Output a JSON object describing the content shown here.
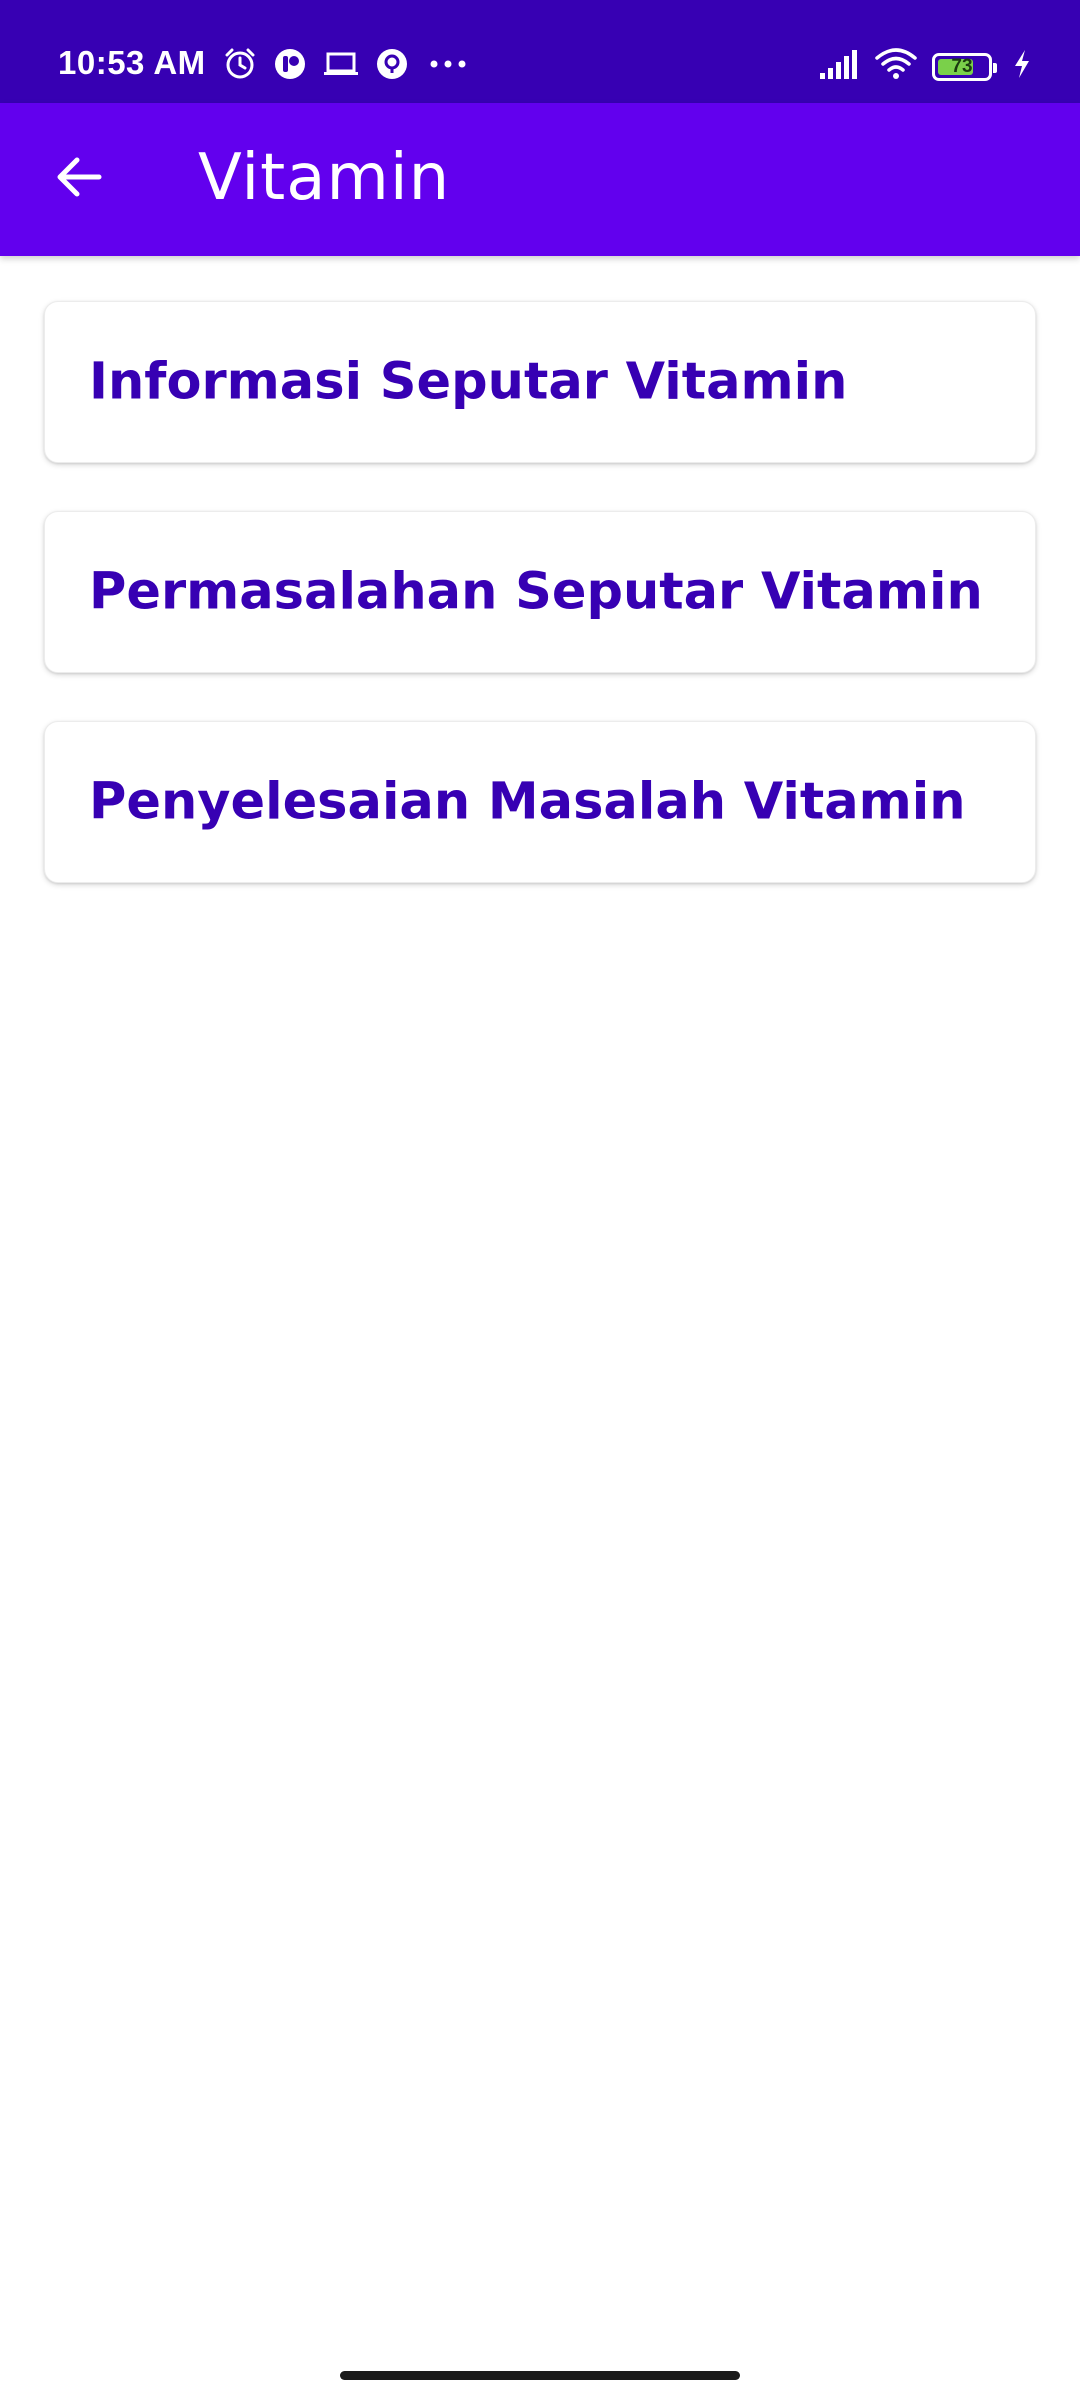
{
  "status_bar": {
    "time": "10:53 AM",
    "battery_level": "73",
    "battery_percent": 73,
    "icons": [
      "alarm-icon",
      "app-notification-icon",
      "laptop-icon",
      "location-icon",
      "more-dots-icon",
      "signal-icon",
      "wifi-icon",
      "battery-icon",
      "charging-icon"
    ]
  },
  "app_bar": {
    "title": "Vitamin",
    "back_icon": "arrow-left-icon"
  },
  "menu": {
    "items": [
      {
        "label": "Informasi Seputar Vitamin"
      },
      {
        "label": "Permasalahan Seputar Vitamin"
      },
      {
        "label": "Penyelesaian Masalah Vitamin"
      }
    ]
  },
  "colors": {
    "status_bar": "#3700b3",
    "app_bar": "#6200ee",
    "card_text": "#3700b3",
    "background": "#ffffff"
  }
}
